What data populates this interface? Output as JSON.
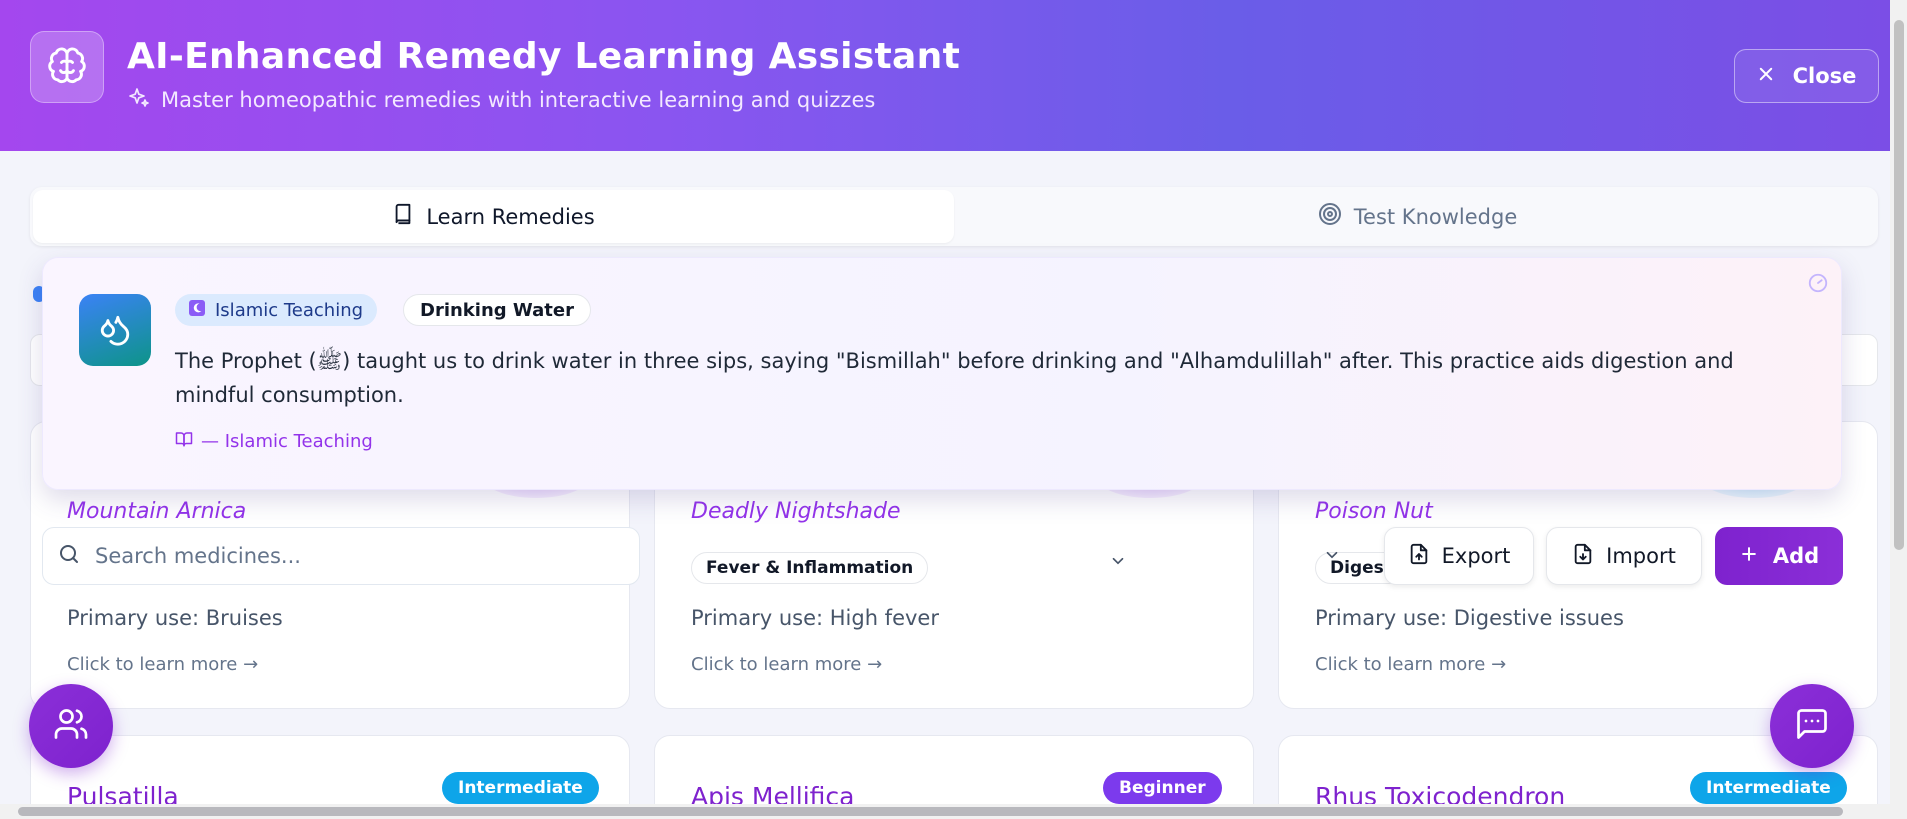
{
  "header": {
    "title": "AI-Enhanced Remedy Learning Assistant",
    "subtitle": "Master homeopathic remedies with interactive learning and quizzes",
    "close_label": "Close"
  },
  "tabs": [
    {
      "label": "Learn Remedies",
      "icon": "book-icon",
      "active": true
    },
    {
      "label": "Test Knowledge",
      "icon": "target-icon",
      "active": false
    }
  ],
  "teaching": {
    "tag": "Islamic Teaching",
    "topic": "Drinking Water",
    "text": "The Prophet (ﷺ) taught us to drink water in three sips, saying \"Bismillah\" before drinking and \"Alhamdulillah\" after. This practice aids digestion and mindful consumption.",
    "source": "— Islamic Teaching"
  },
  "search": {
    "placeholder": "Search medicines..."
  },
  "actions": {
    "export_label": "Export",
    "import_label": "Import",
    "add_label": "Add"
  },
  "remedies_top": [
    {
      "latin": "Mountain Arnica",
      "use": "Primary use: Bruises",
      "more": "Click to learn more →"
    },
    {
      "latin": "Deadly Nightshade",
      "category": "Fever & Inflammation",
      "use": "Primary use: High fever",
      "more": "Click to learn more →"
    },
    {
      "latin": "Poison Nut",
      "category": "Digestive",
      "use": "Primary use: Digestive issues",
      "more": "Click to learn more →"
    }
  ],
  "remedies_bottom": [
    {
      "name": "Pulsatilla",
      "level": "Intermediate",
      "level_color": "#0ea5e9"
    },
    {
      "name": "Apis Mellifica",
      "level": "Beginner",
      "level_color": "#7c3aed"
    },
    {
      "name": "Rhus Toxicodendron",
      "level": "Intermediate",
      "level_color": "#0ea5e9"
    }
  ],
  "colors": {
    "primary": "#7e22ce",
    "header_gradient_start": "#a447ee",
    "header_gradient_end": "#6a5de8"
  }
}
